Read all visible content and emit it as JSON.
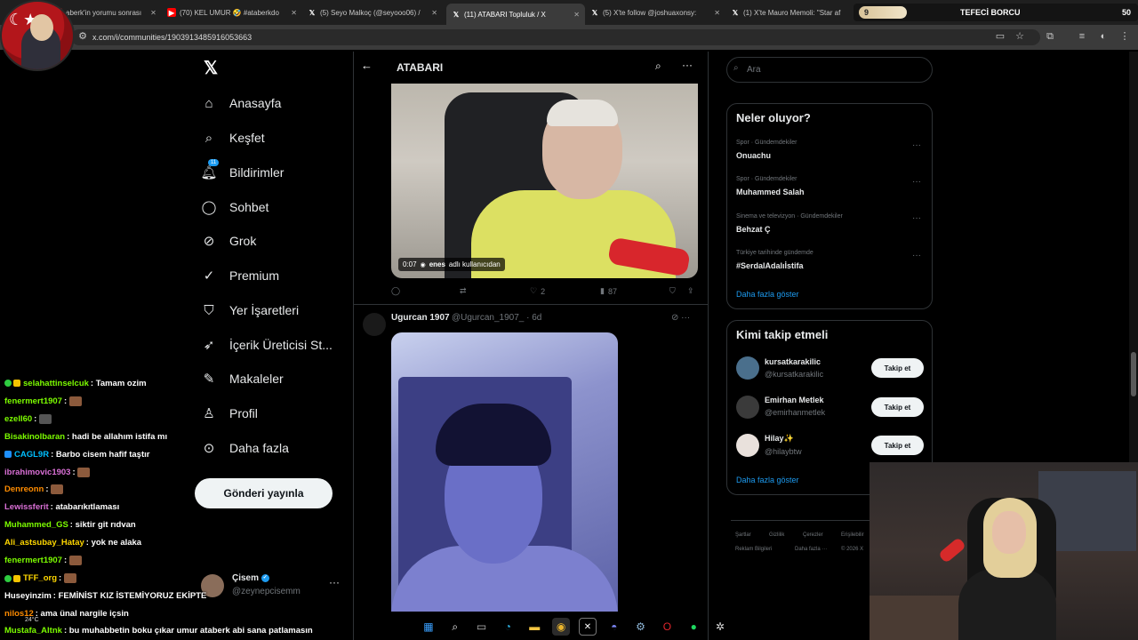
{
  "browser": {
    "tabs": [
      {
        "title": "aberk'in yorumu sonrası",
        "icon": "youtube-icon"
      },
      {
        "title": "(70) KEL UMUR 🤣 #ataberkdo",
        "icon": "youtube-icon"
      },
      {
        "title": "(5) Seyo Malkoç (@seyooo06) /",
        "icon": "x-icon"
      },
      {
        "title": "(11) ATABARI Topluluk / X",
        "icon": "x-icon"
      },
      {
        "title": "(5) X'te follow @joshuaxonsy:",
        "icon": "x-icon"
      },
      {
        "title": "(1) X'te Mauro Memoli: \"Star af",
        "icon": "x-icon"
      }
    ],
    "url": "x.com/i/communities/1903913485916053663"
  },
  "stream_banner": {
    "badge": "9",
    "title": "TEFECİ BORCU",
    "count": "50"
  },
  "nav": {
    "items": [
      {
        "label": "Anasayfa",
        "icon": "home-icon"
      },
      {
        "label": "Keşfet",
        "icon": "search-icon"
      },
      {
        "label": "Bildirimler",
        "icon": "bell-icon",
        "badge": "11"
      },
      {
        "label": "Sohbet",
        "icon": "chat-icon"
      },
      {
        "label": "Grok",
        "icon": "grok-icon"
      },
      {
        "label": "Premium",
        "icon": "premium-icon"
      },
      {
        "label": "Yer İşaretleri",
        "icon": "bookmark-icon"
      },
      {
        "label": "İçerik Üreticisi St...",
        "icon": "rocket-icon"
      },
      {
        "label": "Makaleler",
        "icon": "article-icon"
      },
      {
        "label": "Profil",
        "icon": "person-icon"
      },
      {
        "label": "Daha fazla",
        "icon": "more-circle-icon"
      }
    ],
    "post_button": "Gönderi yayınla",
    "user": {
      "name": "Çisem",
      "handle": "@zeynepcisemm"
    }
  },
  "feed": {
    "community_title": "ATABARI",
    "post1": {
      "video_time": "0:07",
      "video_user": "enes",
      "video_suffix": "adlı kullanıcıdan",
      "likes": "2",
      "views": "87"
    },
    "post2": {
      "name": "Ugurcan 1907",
      "handle": "@Ugurcan_1907_",
      "age": "6d"
    }
  },
  "sidebar": {
    "search_placeholder": "Ara",
    "trends_title": "Neler oluyor?",
    "trends": [
      {
        "meta": "Spor · Gündemdekiler",
        "name": "Onuachu"
      },
      {
        "meta": "Spor · Gündemdekiler",
        "name": "Muhammed Salah"
      },
      {
        "meta": "Sinema ve televizyon · Gündemdekiler",
        "name": "Behzat Ç"
      },
      {
        "meta": "Türkiye tarihinde gündemde",
        "name": "#SerdalAdalıİstifa"
      }
    ],
    "trends_more": "Daha fazla göster",
    "who_title": "Kimi takip etmeli",
    "who": [
      {
        "name": "kursatkarakilic",
        "handle": "@kursatkarakilic",
        "follow": "Takip et"
      },
      {
        "name": "Emirhan Metlek",
        "handle": "@emirhanmetlek",
        "follow": "Takip et"
      },
      {
        "name": "Hilay✨",
        "handle": "@hilaybtw",
        "follow": "Takip et"
      }
    ],
    "who_more": "Daha fazla göster",
    "footer": [
      "Şartlar",
      "Gizlilik",
      "Çerezler",
      "Erişilebilir",
      "Reklam Bilgileri",
      "Daha fazla ···",
      "© 2026 X"
    ]
  },
  "chat": [
    {
      "user": "selahattinselcuk",
      "color": "#7cfc00",
      "msg": ": Tamam ozim",
      "badges": true
    },
    {
      "user": "fenermert1907",
      "color": "#7cfc00",
      "msg": ":",
      "emote": true
    },
    {
      "user": "ezell60",
      "color": "#7cfc00",
      "msg": ":",
      "emote": true
    },
    {
      "user": "Bisakinolbaran",
      "color": "#7cfc00",
      "msg": ": hadi be allahım istifa mı"
    },
    {
      "user": "CAGL9R",
      "color": "#00bfff",
      "msg": ": Barbo cisem hafif taştır"
    },
    {
      "user": "ibrahimovic1903",
      "color": "#da70d6",
      "msg": ":",
      "emote": true
    },
    {
      "user": "Denreonn",
      "color": "#ff8c00",
      "msg": ":",
      "emote": true
    },
    {
      "user": "Lewissferit",
      "color": "#da70d6",
      "msg": ": atabarıkıtlaması"
    },
    {
      "user": "Muhammed_GS",
      "color": "#7cfc00",
      "msg": ": siktir git rıdvan"
    },
    {
      "user": "Ali_astsubay_Hatay",
      "color": "#ffd700",
      "msg": ": yok ne alaka"
    },
    {
      "user": "fenermert1907",
      "color": "#7cfc00",
      "msg": ":",
      "emote": true
    },
    {
      "user": "TFF_org",
      "color": "#ffd700",
      "msg": ":",
      "emote": true,
      "badges": true
    },
    {
      "user": "Huseyinzim",
      "color": "#ffffff",
      "msg": ": FEMİNİST KIZ İSTEMİYORUZ EKİPTE"
    },
    {
      "user": "nilos12",
      "color": "#ff8c00",
      "msg": ": ama ünal nargile içsin"
    },
    {
      "user": "Mustafa_Altnk",
      "color": "#7cfc00",
      "msg": ": bu muhabbetin boku çıkar umur ataberk abi sana patlamasın"
    }
  ],
  "weather": "24°C",
  "taskbar": [
    "windows-icon",
    "search-icon",
    "taskview-icon",
    "edge-icon",
    "files-icon",
    "chrome-icon",
    "x-icon",
    "discord-icon",
    "steam-icon",
    "opera-icon",
    "spotify-icon",
    "settings-icon"
  ],
  "colors": {
    "accent": "#1d9bf0",
    "bg": "#000000",
    "text": "#e7e9ea",
    "muted": "#71767b"
  }
}
